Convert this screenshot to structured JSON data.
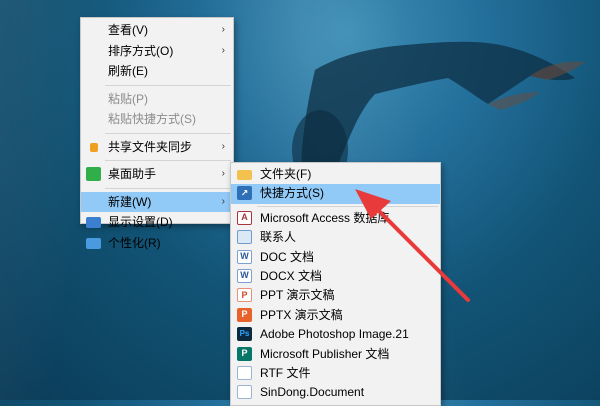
{
  "main_menu": {
    "items": [
      {
        "label": "查看(V)",
        "arrow": "›"
      },
      {
        "label": "排序方式(O)",
        "arrow": "›"
      },
      {
        "label": "刷新(E)"
      },
      {
        "label": "粘贴(P)"
      },
      {
        "label": "粘贴快捷方式(S)"
      },
      {
        "label": "共享文件夹同步",
        "arrow": "›"
      },
      {
        "label": "桌面助手",
        "arrow": "›"
      },
      {
        "label": "新建(W)",
        "arrow": "›"
      },
      {
        "label": "显示设置(D)"
      },
      {
        "label": "个性化(R)"
      }
    ]
  },
  "sub_menu": {
    "items": [
      {
        "label": "文件夹(F)"
      },
      {
        "label": "快捷方式(S)"
      },
      {
        "label": "Microsoft Access 数据库",
        "icon_text": "A"
      },
      {
        "label": "联系人"
      },
      {
        "label": "DOC 文档",
        "icon_text": "W"
      },
      {
        "label": "DOCX 文档",
        "icon_text": "W"
      },
      {
        "label": "PPT 演示文稿",
        "icon_text": "P"
      },
      {
        "label": "PPTX 演示文稿",
        "icon_text": "P"
      },
      {
        "label": "Adobe Photoshop Image.21",
        "icon_text": "Ps"
      },
      {
        "label": "Microsoft Publisher 文档",
        "icon_text": "P"
      },
      {
        "label": "RTF 文件"
      },
      {
        "label": "SinDong.Document"
      }
    ]
  },
  "colors": {
    "highlight": "#91c9f7",
    "annotation_arrow": "#e83a3a"
  }
}
